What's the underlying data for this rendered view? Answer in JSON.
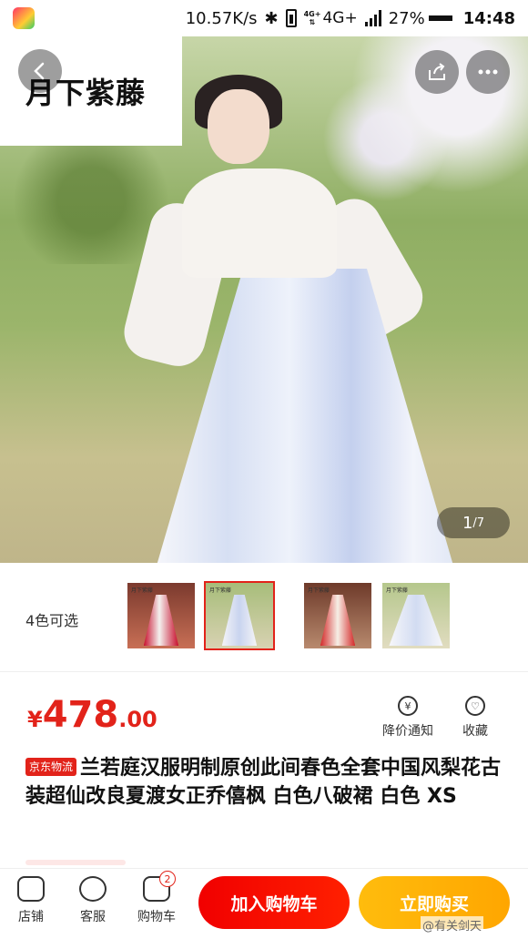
{
  "status_bar": {
    "speed": "10.57K/s",
    "net_tiny_top": "4G+",
    "net_type": "4G+",
    "battery": "27%",
    "time": "14:48"
  },
  "gallery": {
    "brand_text": "月下紫藤",
    "counter_current": "1",
    "counter_total": "/7"
  },
  "colors": {
    "label": "4色可选",
    "thumb_brand": "月下紫藤",
    "options": [
      {
        "name": "red",
        "selected": false
      },
      {
        "name": "white",
        "selected": true
      },
      {
        "name": "red-2",
        "selected": false
      },
      {
        "name": "white-2",
        "selected": false
      }
    ]
  },
  "price": {
    "symbol": "¥",
    "integer": "478",
    "decimal": ".00"
  },
  "actions": {
    "notify_label": "降价通知",
    "fav_label": "收藏"
  },
  "product": {
    "tag": "京东物流",
    "title": "兰若庭汉服明制原创此间春色全套中国风梨花古装超仙改良夏渡女正乔僖枫 白色八破裙 白色 XS"
  },
  "bottom_bar": {
    "store_label": "店铺",
    "service_label": "客服",
    "cart_label": "购物车",
    "cart_count": "2",
    "add_cart_label": "加入购物车",
    "buy_now_label": "立即购买",
    "watermark": "@有关剑天"
  },
  "theme": {
    "accent": "#e2231a",
    "buy_color": "#ffa600"
  }
}
